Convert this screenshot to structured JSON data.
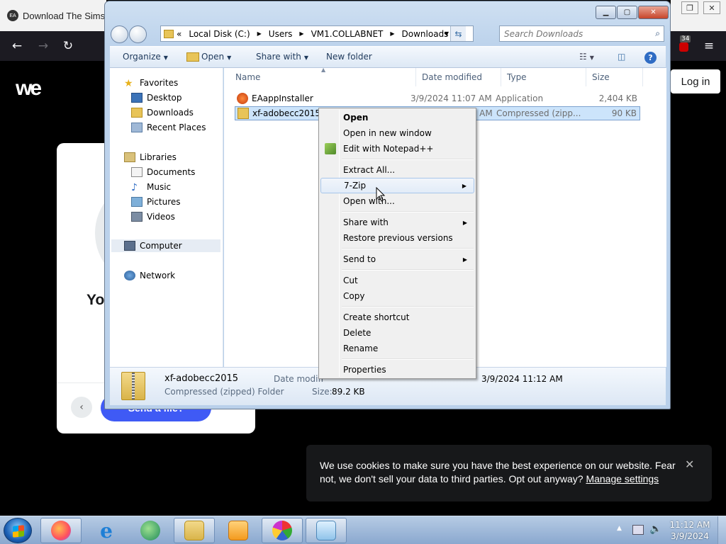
{
  "browser": {
    "tab_title": "Download The Sims™",
    "extension_badge": "34",
    "nav_icons": [
      "back-icon",
      "forward-icon",
      "reload-icon",
      "menu-icon"
    ]
  },
  "webpage": {
    "logo": "we",
    "login_label": "Log in",
    "card_heading": "Yo",
    "send_button": "Send a file?",
    "cookie_text": "We use cookies to make sure you have the best experience on our website. Fear not, we don't sell your data to third parties. Opt out anyway?",
    "cookie_link": "Manage settings",
    "cookie_close": "✕"
  },
  "explorer": {
    "address": {
      "overflow": "«",
      "crumbs": [
        "Local Disk (C:)",
        "Users",
        "VM1.COLLABNET",
        "Downloads"
      ]
    },
    "search_placeholder": "Search Downloads",
    "toolbar": {
      "organize": "Organize",
      "open": "Open",
      "share_with": "Share with",
      "new_folder": "New folder"
    },
    "nav": {
      "favorites": "Favorites",
      "desktop": "Desktop",
      "downloads": "Downloads",
      "recent": "Recent Places",
      "libraries": "Libraries",
      "documents": "Documents",
      "music": "Music",
      "pictures": "Pictures",
      "videos": "Videos",
      "computer": "Computer",
      "network": "Network"
    },
    "columns": [
      "Name",
      "Date modified",
      "Type",
      "Size"
    ],
    "files": [
      {
        "name": "EAappInstaller",
        "date": "3/9/2024 11:07 AM",
        "type": "Application",
        "size": "2,404 KB"
      },
      {
        "name": "xf-adobecc2015",
        "date": "3/9/2024 11:12 AM",
        "type": "Compressed (zipp...",
        "size": "90 KB"
      }
    ],
    "details": {
      "name": "xf-adobecc2015",
      "kind": "Compressed (zipped) Folder",
      "date_modified_label": "Date modifi",
      "date_created_value": "3/9/2024 11:12 AM",
      "size_label": "Size:",
      "size_value": "89.2 KB"
    }
  },
  "context_menu": {
    "items": [
      {
        "label": "Open"
      },
      {
        "label": "Open in new window"
      },
      {
        "label": "Edit with Notepad++"
      },
      {
        "label": "Extract All..."
      },
      {
        "label": "7-Zip"
      },
      {
        "label": "Open with..."
      },
      {
        "label": "Share with"
      },
      {
        "label": "Restore previous versions"
      },
      {
        "label": "Send to"
      },
      {
        "label": "Cut"
      },
      {
        "label": "Copy"
      },
      {
        "label": "Create shortcut"
      },
      {
        "label": "Delete"
      },
      {
        "label": "Rename"
      },
      {
        "label": "Properties"
      }
    ]
  },
  "taskbar": {
    "clock_time": "11:12 AM",
    "clock_date": "3/9/2024",
    "apps": [
      "firefox-icon",
      "internet-explorer-icon",
      "messenger-icon",
      "file-explorer-icon",
      "media-player-icon",
      "paint-icon",
      "notepad-icon"
    ]
  },
  "colors": {
    "selection": "#cce4fb",
    "send_button": "#3f5af5",
    "window_frame": "#bdd3ec"
  }
}
